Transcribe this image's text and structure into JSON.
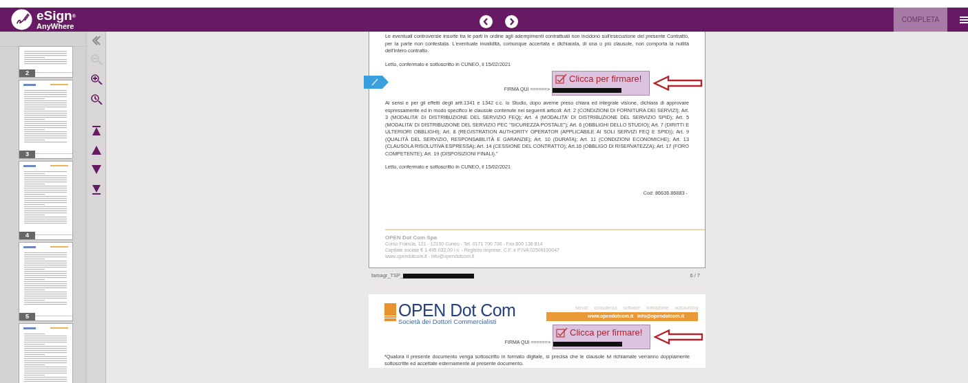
{
  "header": {
    "brand": "eSign",
    "brand_mark": "®",
    "brand_subtitle": "AnyWhere",
    "complete_button": "COMPLETA"
  },
  "thumbnails": [
    {
      "kind": "cut-top",
      "label": "2"
    },
    {
      "kind": "full",
      "label": "3"
    },
    {
      "kind": "full",
      "label": "4"
    },
    {
      "kind": "full",
      "label": "5"
    },
    {
      "kind": "cut-bottom"
    }
  ],
  "tools": [
    {
      "kind": "collapse",
      "disabled": false
    },
    {
      "kind": "zoom-out",
      "disabled": true
    },
    {
      "kind": "zoom-in",
      "disabled": false
    },
    {
      "kind": "zoom-reset",
      "disabled": false
    },
    {
      "kind": "first",
      "disabled": false
    },
    {
      "kind": "previous",
      "disabled": false
    },
    {
      "kind": "next",
      "disabled": false
    },
    {
      "kind": "last",
      "disabled": false
    }
  ],
  "pages": [
    {
      "caption": "famagr_TSP_",
      "page_count": "6 / 7",
      "blocks": [
        {
          "kind": "paragraph",
          "text": "Le eventuali controversie insorte tra le parti in ordine agli adempimenti contrattuali non incidono sull'esecuzione del presente Contratto, per la parte non contestata. L'eventuale invalidità, comunque accertata e dichiarata, di una o più clausole, non comporta la nullità dell'intero contratto."
        },
        {
          "kind": "paragraph",
          "text": "Letto, confermato e sottoscritto in CUNEO, il 15/02/2021"
        },
        {
          "kind": "signature",
          "label": "FIRMA QUI ======>",
          "button": "Clicca per firmare!",
          "marker": true
        },
        {
          "kind": "paragraph",
          "text": "Ai sensi e per gli effetti degli artt.1341 e 1342 c.c. lo Studio, dopo averne preso chiara ed integrale visione, dichiara di approvare espressamente ed in modo specifico le clausole contenute nei seguenti articoli: Art. 2 (CONDIZIONI DI FORNITURA DEI SERVIZI); Art. 3 (MODALITA' DI DISTRIBUZIONE DEL SERVIZIO FEQ); Art. 4 (MODALITA' DI DISTRIBUZIONE DEL SERVIZIO SPID); Art. 5 (MODALITA' DI DISTRIBUZIONE DEL SERVIZIO PEC \"SICUREZZA POSTALE\"); Art. 6 (OBBLIGHI DELLO STUDIO); Art. 7 (DIRITTI E ULTERIORI OBBLIGHI); Art. 8 (REGISTRATION AUTHORITY OPERATOR (APPLICABILE AI SOLI SERVIZI FEQ E SPID)); Art. 9 (QUALITÀ DEL SERVIZIO, RESPONSABILITÀ E GARANZIE); Art. 10 (DURATA); Art. 11 (CONDIZIONI ECONOMICHE); Art. 13 (CLAUSOLA RISOLUTIVA ESPRESSA); Art. 14 (CESSIONE DEL CONTRATTO); Art.16 (OBBLIGO DI RISERVATEZZA); Art. 17 (FORO COMPETENTE); Art. 19 (DISPOSIZIONI FINALI).\""
        },
        {
          "kind": "paragraph",
          "text": "Letto, confermato e sottoscritto in CUNEO, il 15/02/2021"
        },
        {
          "kind": "code",
          "text": "Cod: 86636.86883 -"
        },
        {
          "kind": "footer",
          "title": "OPEN Dot Com Spa",
          "lines": [
            "Corso Francia, 121 - 12100 Cuneo - Tel. 0171 700 700 - Fax 800 136 814",
            "Capitale sociale € 1.495.032,00 i.v. - Registro Imprese, C.F. e P.IVA 02506100047"
          ],
          "contacts": "www.opendotcom.it - info@opendotcom.it"
        }
      ]
    },
    {
      "blocks": [
        {
          "kind": "letterhead",
          "title": "OPEN Dot Com",
          "subtitle": "Società dei Dottori Commercialisti",
          "menu": [
            "servizi",
            "consulenza",
            "software",
            "formazione",
            "outsourcing"
          ],
          "contacts": "www.opendotcom.it   info@opendotcom.it"
        },
        {
          "kind": "signature",
          "label": "FIRMA QUI ======>",
          "button": "Clicca per firmare!",
          "marker": false
        },
        {
          "kind": "paragraph",
          "text": "*Qualora il presente documento venga sottoscritto in formato digitale, si precisa che le clausole ivi richiamate verranno doppiamente sottoscritte ed accettate esternamente al presente documento."
        }
      ]
    }
  ]
}
